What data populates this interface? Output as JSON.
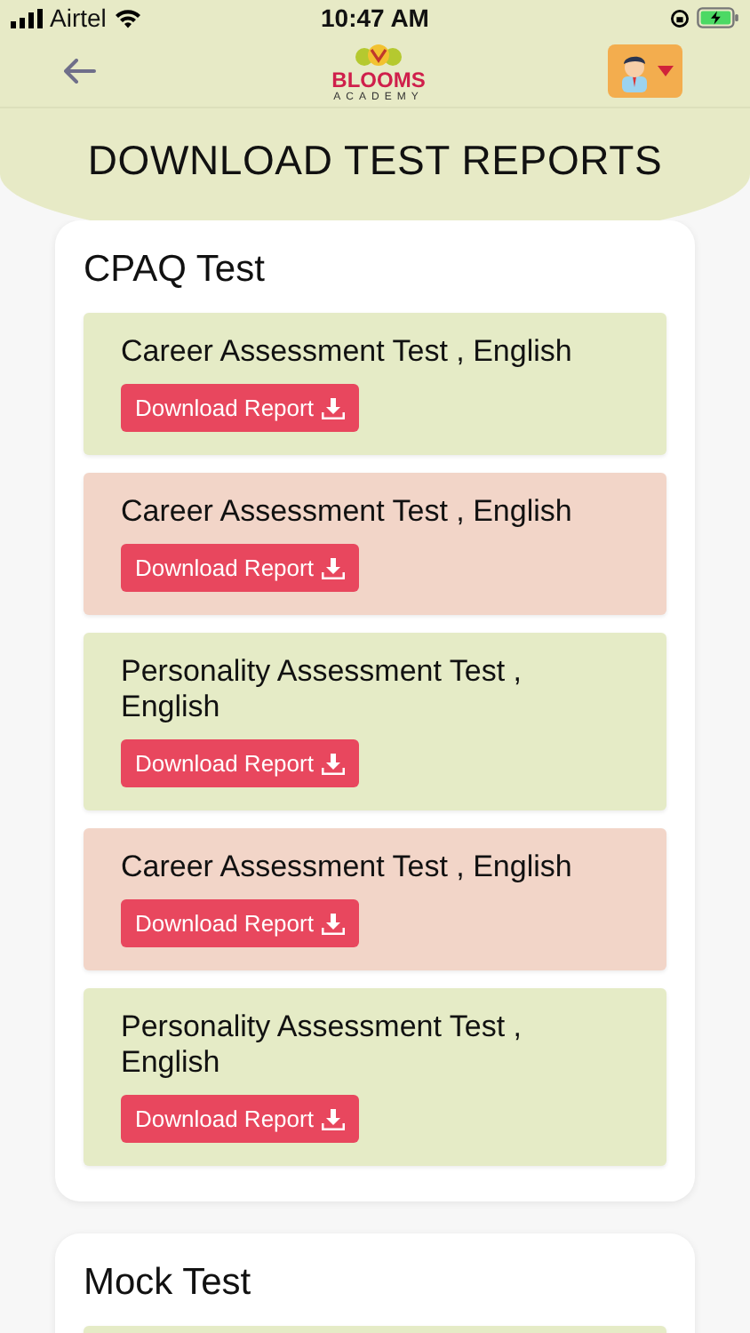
{
  "status_bar": {
    "carrier": "Airtel",
    "time": "10:47 AM"
  },
  "header": {
    "logo_title": "BLOOMS",
    "logo_subtitle": "ACADEMY"
  },
  "page_title": "DOWNLOAD TEST REPORTS",
  "sections": [
    {
      "title": "CPAQ Test",
      "reports": [
        {
          "name": "Career Assessment Test , English",
          "button": "Download Report",
          "color": "#e5ebc6"
        },
        {
          "name": "Career Assessment Test , English",
          "button": "Download Report",
          "color": "#f2d5c8"
        },
        {
          "name": "Personality Assessment Test , English",
          "button": "Download Report",
          "color": "#e5ebc6"
        },
        {
          "name": "Career Assessment Test , English",
          "button": "Download Report",
          "color": "#f2d5c8"
        },
        {
          "name": "Personality Assessment Test , English",
          "button": "Download Report",
          "color": "#e5ebc6"
        }
      ]
    },
    {
      "title": "Mock Test",
      "reports": [
        {
          "color": "#e5ebc6"
        }
      ]
    }
  ]
}
